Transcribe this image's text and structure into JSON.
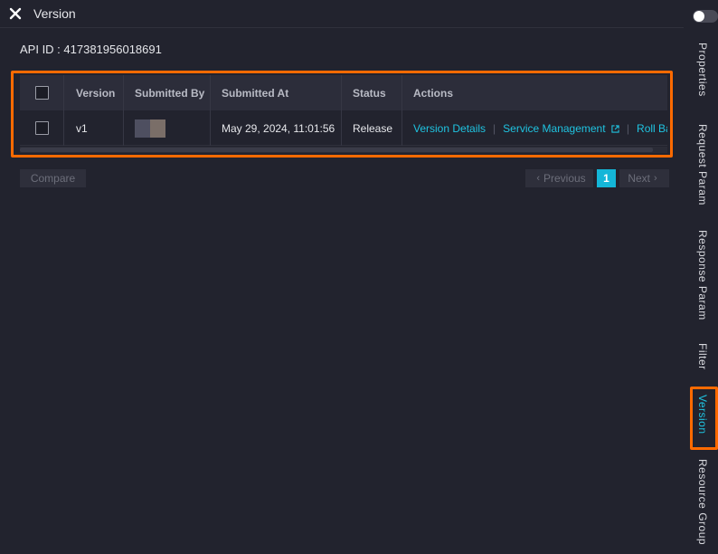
{
  "panel": {
    "title": "Version",
    "api_id_label": "API ID : 417381956018691"
  },
  "table": {
    "columns": [
      "Version",
      "Submitted By",
      "Submitted At",
      "Status",
      "Actions"
    ],
    "rows": [
      {
        "version": "v1",
        "submitted_by": "",
        "submitted_at": "May 29, 2024, 11:01:56",
        "status": "Release",
        "actions": [
          "Version Details",
          "Service Management",
          "Roll Back"
        ]
      }
    ]
  },
  "footer": {
    "compare_label": "Compare",
    "previous_label": "Previous",
    "next_label": "Next",
    "current_page": "1"
  },
  "sidebar": {
    "tabs": [
      {
        "label": "Properties",
        "active": false
      },
      {
        "label": "Request Param",
        "active": false
      },
      {
        "label": "Response Param",
        "active": false
      },
      {
        "label": "Filter",
        "active": false
      },
      {
        "label": "Version",
        "active": true
      },
      {
        "label": "Resource Group",
        "active": false
      }
    ]
  },
  "colors": {
    "accent": "#1fc3e0",
    "highlight": "#ff6a00",
    "background": "#22232e"
  },
  "icons": {
    "close": "close-icon",
    "external_link": "external-link-icon",
    "chevron_left": "chevron-left-icon",
    "chevron_right": "chevron-right-icon"
  }
}
